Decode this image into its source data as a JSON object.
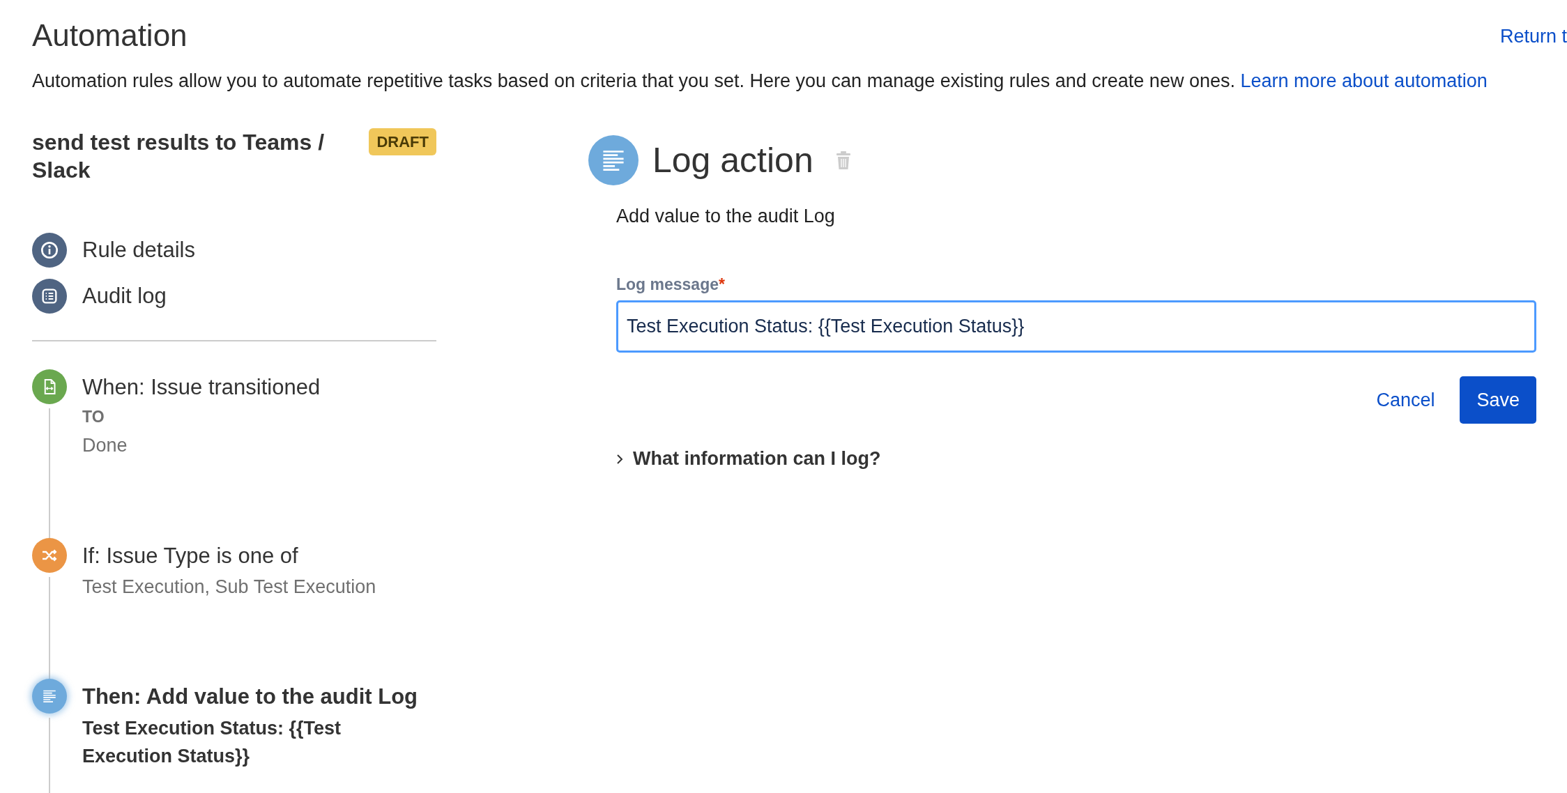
{
  "header": {
    "title": "Automation",
    "return_link": "Return t",
    "description": "Automation rules allow you to automate repetitive tasks based on criteria that you set. Here you can manage existing rules and create new ones.",
    "learn_more_link": "Learn more about automation"
  },
  "rule": {
    "name": "send test results to Teams / Slack",
    "status_badge": "DRAFT"
  },
  "nav_items": [
    {
      "kind": "info",
      "label": "Rule details"
    },
    {
      "kind": "list",
      "label": "Audit log"
    }
  ],
  "steps": [
    {
      "kind": "trigger",
      "title": "When: Issue transitioned",
      "selected": false,
      "details": [
        {
          "kind": "label",
          "text": "TO"
        },
        {
          "kind": "value",
          "text": "Done"
        }
      ]
    },
    {
      "kind": "condition",
      "title": "If: Issue Type is one of",
      "selected": false,
      "details": [
        {
          "kind": "value",
          "text": "Test Execution, Sub Test Execution"
        }
      ]
    },
    {
      "kind": "action",
      "title": "Then: Add value to the audit Log",
      "selected": true,
      "details": [
        {
          "kind": "value",
          "text": "Test Execution Status: {{Test Execution Status}}"
        }
      ]
    }
  ],
  "panel": {
    "title": "Log action",
    "subtitle": "Add value to the audit Log",
    "field": {
      "label": "Log message",
      "required_mark": "*",
      "value": "Test Execution Status: {{Test Execution Status}}"
    },
    "buttons": [
      {
        "kind": "link",
        "label": "Cancel"
      },
      {
        "kind": "primary",
        "label": "Save"
      }
    ],
    "expander": {
      "label": "What information can I log?",
      "expanded": false
    }
  }
}
